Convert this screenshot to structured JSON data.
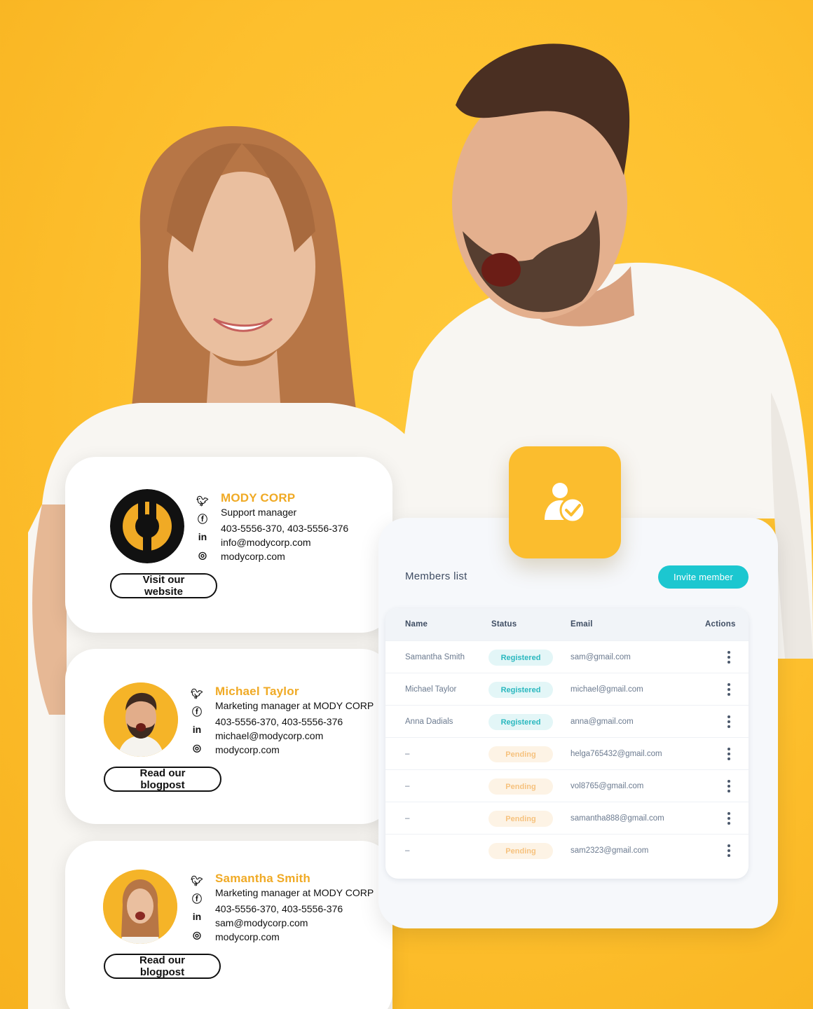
{
  "signatures": [
    {
      "name": "MODY CORP",
      "role": "Support manager",
      "phone": "403-5556-370, 403-5556-376",
      "email": "info@modycorp.com",
      "website": "modycorp.com",
      "button": "Visit our website",
      "image": "mody-corp-logo"
    },
    {
      "name": "Michael Taylor",
      "role": "Marketing manager at MODY CORP",
      "phone": "403-5556-370, 403-5556-376",
      "email": "michael@modycorp.com",
      "website": "modycorp.com",
      "button": "Read our blogpost",
      "image": "michael-avatar"
    },
    {
      "name": "Samantha Smith",
      "role": "Marketing manager at MODY CORP",
      "phone": "403-5556-370, 403-5556-376",
      "email": "sam@modycorp.com",
      "website": "modycorp.com",
      "button": "Read our blogpost",
      "image": "samantha-avatar"
    }
  ],
  "social_icons": [
    "twitter-icon",
    "facebook-icon",
    "linkedin-icon",
    "instagram-icon"
  ],
  "members": {
    "title": "Members list",
    "invite_label": "Invite member",
    "columns": [
      "Name",
      "Status",
      "Email",
      "Actions"
    ],
    "rows": [
      {
        "name": "Samantha Smith",
        "status": "Registered",
        "email": "sam@gmail.com"
      },
      {
        "name": "Michael Taylor",
        "status": "Registered",
        "email": "michael@gmail.com"
      },
      {
        "name": "Anna Dadials",
        "status": "Registered",
        "email": "anna@gmail.com"
      },
      {
        "name": "–",
        "status": "Pending",
        "email": "helga765432@gmail.com"
      },
      {
        "name": "–",
        "status": "Pending",
        "email": "vol8765@gmail.com"
      },
      {
        "name": "–",
        "status": "Pending",
        "email": "samantha888@gmail.com"
      },
      {
        "name": "–",
        "status": "Pending",
        "email": "sam2323@gmail.com"
      }
    ],
    "badge_icon": "user-check-icon"
  },
  "colors": {
    "background": "#fdbf2d",
    "brand_accent": "#f0aa25",
    "invite_button": "#1cc7d0",
    "registered": "#2ab8bf",
    "pending": "#f6c27e"
  }
}
